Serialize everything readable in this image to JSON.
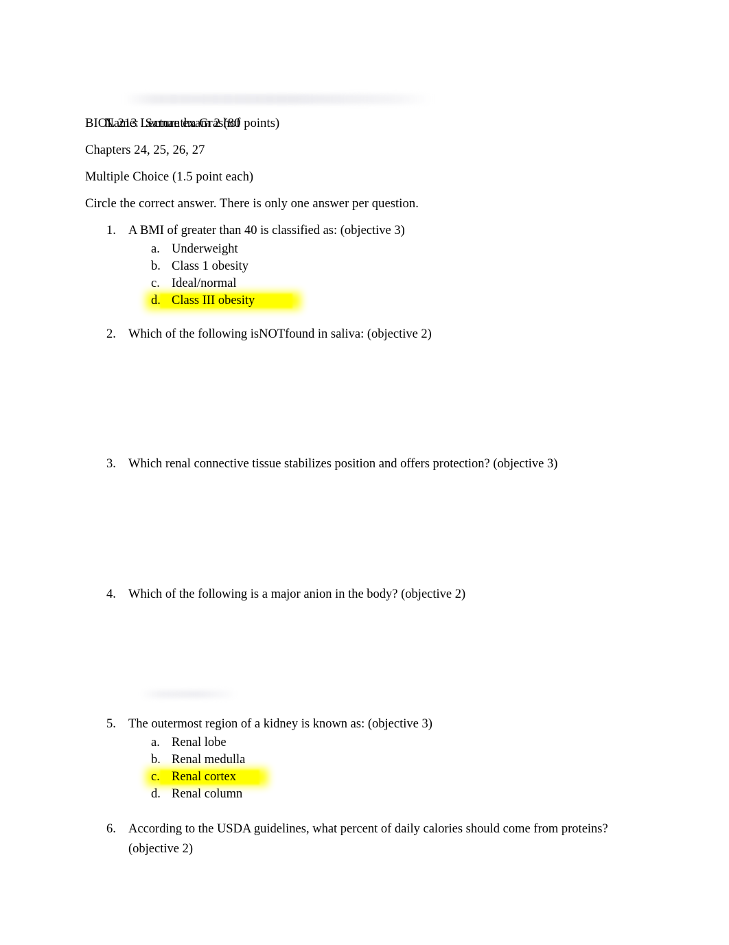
{
  "document": {
    "type": "exam-worksheet",
    "background_color": "#ffffff",
    "text_color": "#000000",
    "highlight_color": "#ffff00"
  },
  "header": {
    "name_label": "Name:",
    "name_value": "Samantha Grashof",
    "course_line": "BIOL 213 Lecture exam 2 (80 points)",
    "chapters_line": "Chapters 24, 25, 26, 27",
    "section_line": "Multiple Choice (1.5 point each)",
    "instruction_line": "Circle the correct answer. There is only one answer per question."
  },
  "questions": [
    {
      "number": "1.",
      "text": "A BMI of greater than 40 is classified as: (objective 3)",
      "options": [
        {
          "letter": "a.",
          "text": "Underweight",
          "highlighted": false
        },
        {
          "letter": "b.",
          "text": "Class 1 obesity",
          "highlighted": false
        },
        {
          "letter": "c.",
          "text": "Ideal/normal",
          "highlighted": false
        },
        {
          "letter": "d.",
          "text": "Class III obesity",
          "highlighted": true
        }
      ]
    },
    {
      "number": "2.",
      "text": "Which of the following isNOTfound in saliva: (objective 2)",
      "options": []
    },
    {
      "number": "3.",
      "text": "Which renal connective tissue stabilizes position and offers protection? (objective 3)",
      "options": []
    },
    {
      "number": "4.",
      "text": "Which of the following is a major anion in the body? (objective 2)",
      "options": []
    },
    {
      "number": "5.",
      "text": "The outermost region of a kidney is known as: (objective 3)",
      "options": [
        {
          "letter": "a.",
          "text": "Renal lobe",
          "highlighted": false
        },
        {
          "letter": "b.",
          "text": "Renal medulla",
          "highlighted": false
        },
        {
          "letter": "c.",
          "text": "Renal cortex",
          "highlighted": true
        },
        {
          "letter": "d.",
          "text": "Renal column",
          "highlighted": false
        }
      ]
    },
    {
      "number": "6.",
      "text": "According to the USDA guidelines, what percent of daily calories should come from proteins? (objective 2)",
      "options": []
    }
  ],
  "layout": {
    "question_tops": [
      322,
      473,
      662,
      852,
      1041,
      1194
    ],
    "question_widths": [
      820,
      820,
      820,
      820,
      820,
      760
    ]
  }
}
